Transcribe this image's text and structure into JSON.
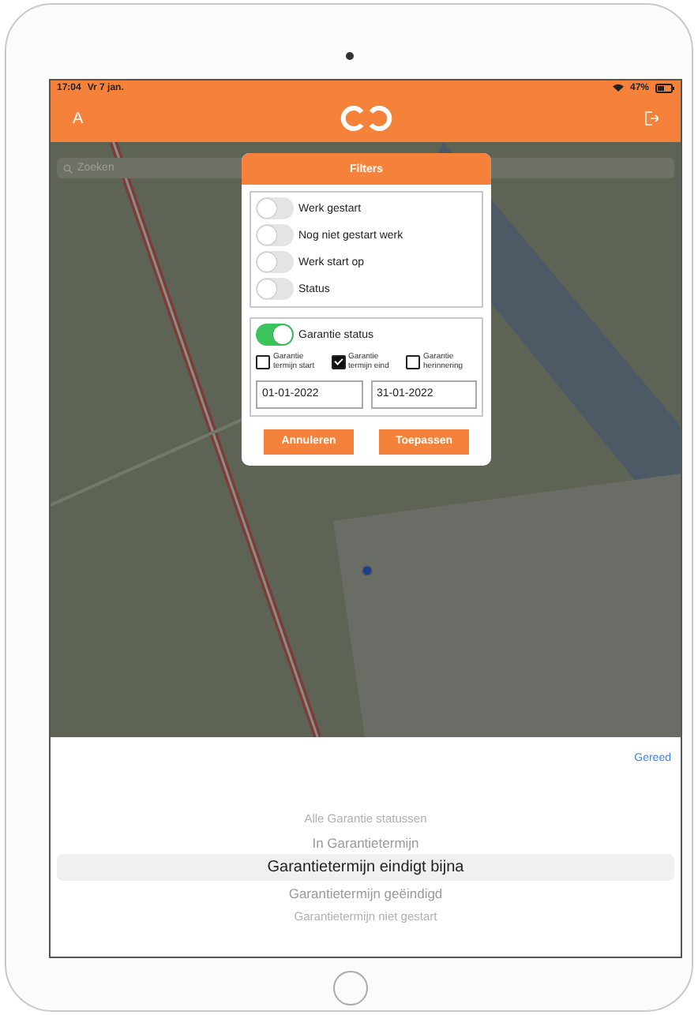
{
  "status_bar": {
    "time": "17:04",
    "date": "Vr 7 jan.",
    "battery": "47%"
  },
  "nav": {
    "left": "A"
  },
  "search": {
    "placeholder": "Zoeken"
  },
  "filters": {
    "title": "Filters",
    "toggles": [
      {
        "label": "Werk gestart",
        "on": false
      },
      {
        "label": "Nog niet gestart werk",
        "on": false
      },
      {
        "label": "Werk start op",
        "on": false
      },
      {
        "label": "Status",
        "on": false
      }
    ],
    "warranty": {
      "label": "Garantie status",
      "on": true,
      "checkboxes": [
        {
          "label": "Garantie termijn start",
          "checked": false
        },
        {
          "label": "Garantie termijn eind",
          "checked": true
        },
        {
          "label": "Garantie herinnering",
          "checked": false
        }
      ],
      "dates": [
        "01-01-2022",
        "31-01-2022"
      ]
    },
    "buttons": [
      "Annuleren",
      "Toepassen"
    ]
  },
  "picker": {
    "done": "Gereed",
    "options": [
      {
        "label": "Alle Garantie statussen",
        "selected": false
      },
      {
        "label": "In Garantietermijn",
        "selected": false
      },
      {
        "label": "Garantietermijn eindigt bijna",
        "selected": true
      },
      {
        "label": "Garantietermijn geëindigd",
        "selected": false
      },
      {
        "label": "Garantietermijn niet gestart",
        "selected": false
      }
    ]
  }
}
